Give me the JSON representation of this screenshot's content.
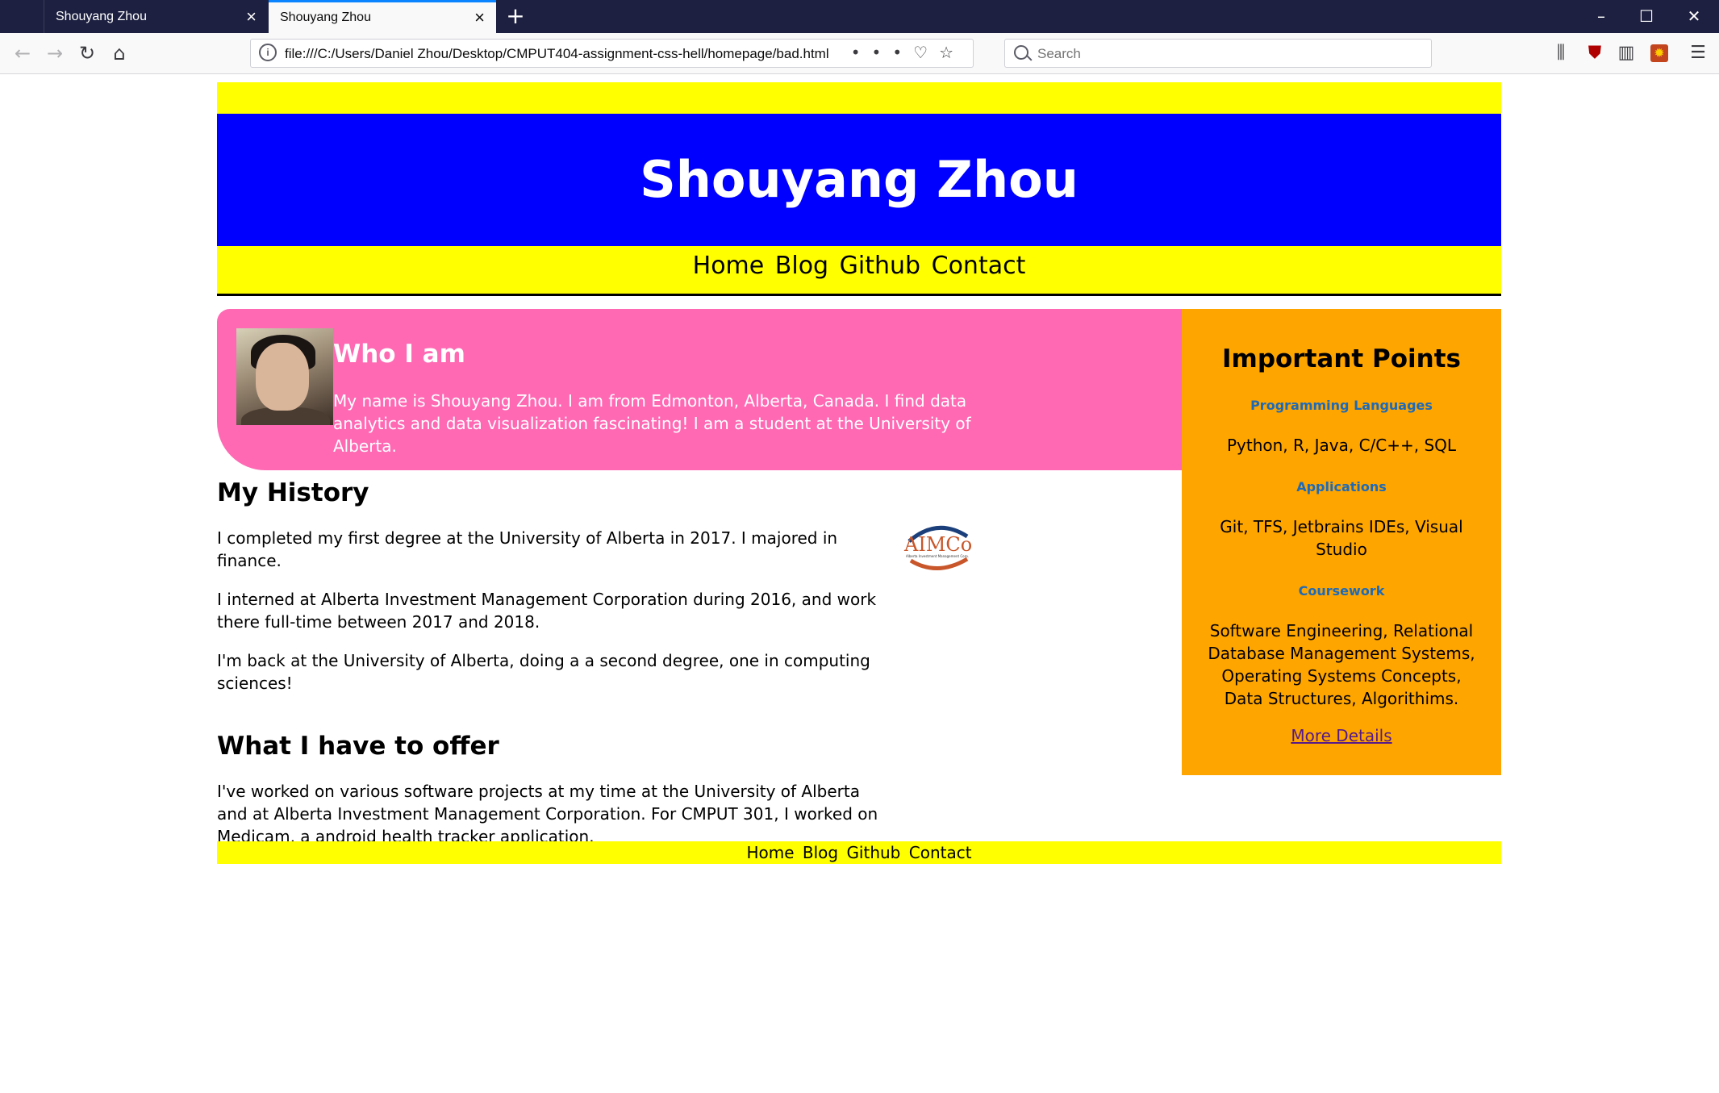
{
  "browser": {
    "tabs": [
      {
        "title": "Shouyang Zhou",
        "active": false
      },
      {
        "title": "Shouyang Zhou",
        "active": true
      }
    ],
    "url": "file:///C:/Users/Daniel Zhou/Desktop/CMPUT404-assignment-css-hell/homepage/bad.html",
    "search_placeholder": "Search",
    "accent_color": "#0a84ff"
  },
  "site": {
    "title": "Shouyang Zhou",
    "nav": [
      "Home",
      "Blog",
      "Github",
      "Contact"
    ],
    "colors": {
      "band": "#ffff00",
      "header": "#0000ff",
      "about": "#ff69b4",
      "sidebar": "#ffa500"
    }
  },
  "about": {
    "title": "Who I am",
    "text": "My name is Shouyang Zhou. I am from Edmonton, Alberta, Canada. I find data analytics and data visualization fascinating! I am a student at the University of Alberta."
  },
  "history": {
    "title": "My History",
    "paragraphs": [
      "I completed my first degree at the University of Alberta in 2017. I majored in finance.",
      "I interned at Alberta Investment Management Corporation during 2016, and work there full-time between 2017 and 2018.",
      "I'm back at the University of Alberta, doing a a second degree, one in computing sciences!"
    ],
    "logo_text": "AIMCo",
    "logo_subtext": "Alberta Investment Management Corp."
  },
  "offer": {
    "title": "What I have to offer",
    "text": "I've worked on various software projects at my time at the University of Alberta and at Alberta Investment Management Corporation. For CMPUT 301, I worked on Medicam, a android health tracker application."
  },
  "sidebar": {
    "title": "Important Points",
    "sections": [
      {
        "heading": "Programming Languages",
        "text": "Python, R, Java, C/C++, SQL"
      },
      {
        "heading": "Applications",
        "text": "Git, TFS, Jetbrains IDEs, Visual Studio"
      },
      {
        "heading": "Coursework",
        "text": "Software Engineering, Relational Database Management Systems, Operating Systems Concepts, Data Structures, Algorithims."
      }
    ],
    "link": "More Details"
  },
  "footer": {
    "nav": [
      "Home",
      "Blog",
      "Github",
      "Contact"
    ]
  }
}
